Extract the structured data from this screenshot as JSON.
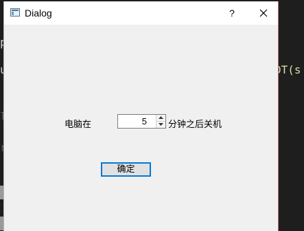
{
  "background": {
    "fragments": [
      "p",
      "u",
      "DT(s",
      "l",
      "r"
    ]
  },
  "window": {
    "title": "Dialog",
    "help_label": "?",
    "close_icon": "close-icon"
  },
  "form": {
    "label_before": "电脑在",
    "minutes_value": "5",
    "label_after": "分钟之后关机",
    "confirm_label": "确定"
  },
  "colors": {
    "accent": "#0078d7",
    "dialog_bg": "#f0f0f0"
  }
}
